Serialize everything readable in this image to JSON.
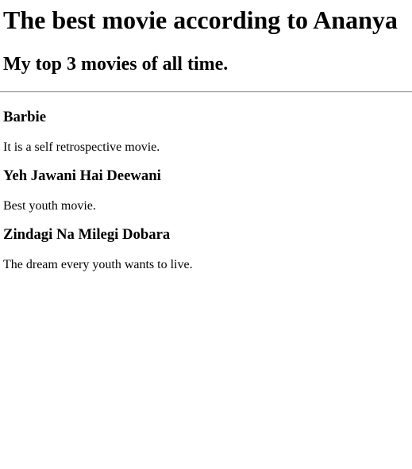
{
  "page": {
    "title": "The best movie according to Ananya",
    "subtitle": "My top 3 movies of all time."
  },
  "movies": [
    {
      "title": "Barbie",
      "description": "It is a self retrospective movie."
    },
    {
      "title": "Yeh Jawani Hai Deewani",
      "description": "Best youth movie."
    },
    {
      "title": "Zindagi Na Milegi Dobara",
      "description": "The dream every youth wants to live."
    }
  ]
}
